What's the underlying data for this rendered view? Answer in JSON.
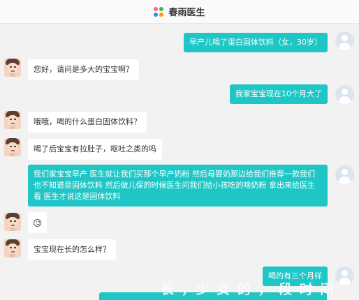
{
  "header": {
    "title": "春雨医生",
    "logo_icon": "four-dots-logo-icon"
  },
  "messages": [
    {
      "side": "right",
      "text": "早产儿喝了蛋白固体饮料（女，30岁）"
    },
    {
      "side": "left",
      "text": "您好，请问是多大的宝宝啊？"
    },
    {
      "side": "right",
      "text": "我家宝宝现在10个月大了"
    },
    {
      "side": "left",
      "text": "哦哦，喝的什么蛋白固体饮料？"
    },
    {
      "side": "left",
      "text": "喝了后宝宝有拉肚子，呕吐之类的吗"
    },
    {
      "side": "right",
      "text": "我们家宝宝早产 医生就让我们买那个早产奶粉 然后母婴奶那边给我们推荐一款我们也不知道是固体饮料 然后做儿保的时候医生问我们给小孩吃的啥奶粉 拿出来给医生看 医生才说这是固体饮料"
    },
    {
      "side": "left",
      "text": "☺",
      "icon": "smile-emoji-icon"
    },
    {
      "side": "left",
      "text": "宝宝现在长的怎么样？"
    },
    {
      "side": "right",
      "text": "喝的有三个月样"
    },
    {
      "side": "right",
      "text": ""
    }
  ],
  "watermark": "长 ，少 女 的 ， 段 时 间",
  "colors": {
    "accent": "#1ec6c6",
    "background": "#f2f2f2",
    "left_bubble": "#ffffff"
  }
}
